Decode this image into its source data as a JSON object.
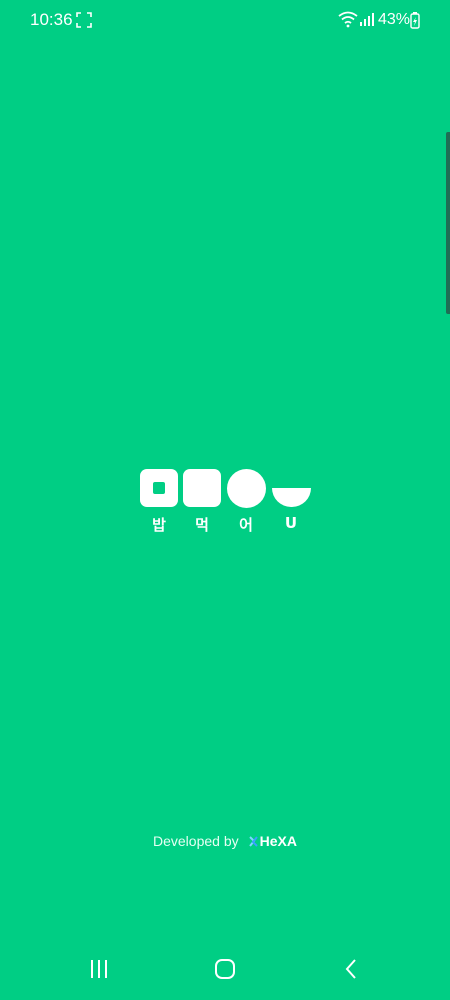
{
  "status_bar": {
    "time": "10:36",
    "battery": "43%",
    "icons": [
      "screenshot-icon",
      "wifi-icon",
      "signal-icon",
      "battery-charging-icon"
    ]
  },
  "splash": {
    "background_color": "#00CE84",
    "logo": {
      "shapes": [
        "square-with-hole",
        "square",
        "circle",
        "half-circle-bowl"
      ],
      "chars": [
        "밥",
        "먹",
        "어",
        "U"
      ]
    }
  },
  "footer": {
    "developed_by": "Developed by",
    "brand": "HeXA"
  },
  "nav_bar": {
    "icons": [
      "recents-icon",
      "home-icon",
      "back-icon"
    ]
  }
}
